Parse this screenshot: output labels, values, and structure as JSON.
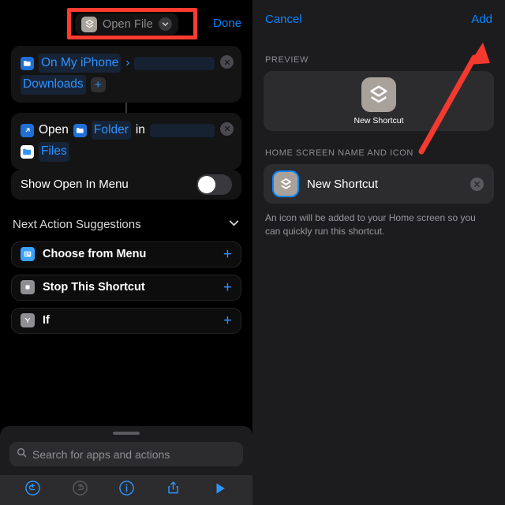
{
  "left": {
    "header": {
      "title_icon": "shortcut-layers-icon",
      "title": "Open File",
      "chevron_icon": "chevron-down-icon",
      "done_label": "Done"
    },
    "action_cards": [
      {
        "name": "file-picker-action",
        "icon": "folder-icon",
        "tokens": [
          "On My iPhone",
          "›",
          "Downloads"
        ],
        "add_label": "+",
        "remove_icon": "close-icon"
      },
      {
        "name": "open-folder-action",
        "icon": "open-app-icon",
        "word_open": "Open",
        "token_folder": "Folder",
        "word_in": "in",
        "token_files": "Files",
        "remove_icon": "close-icon"
      }
    ],
    "toggle": {
      "label": "Show Open In Menu",
      "state": "off"
    },
    "suggestions": {
      "title": "Next Action Suggestions",
      "collapse_icon": "chevron-down-icon",
      "items": [
        {
          "label": "Choose from Menu",
          "icon": "menu-icon",
          "icon_color": "#3aa3ff",
          "add": "+"
        },
        {
          "label": "Stop This Shortcut",
          "icon": "stop-square-icon",
          "icon_color": "#8e8e93",
          "add": "+"
        },
        {
          "label": "If",
          "icon": "branch-icon",
          "icon_color": "#8e8e93",
          "add": "+"
        }
      ]
    },
    "search": {
      "placeholder": "Search for apps and actions",
      "icon": "search-icon"
    },
    "toolbar": [
      {
        "name": "undo-button",
        "icon": "undo-icon",
        "enabled": true
      },
      {
        "name": "redo-button",
        "icon": "redo-icon",
        "enabled": false
      },
      {
        "name": "info-button",
        "icon": "info-icon",
        "enabled": true
      },
      {
        "name": "share-button",
        "icon": "share-icon",
        "enabled": true
      },
      {
        "name": "run-button",
        "icon": "play-icon",
        "enabled": true
      }
    ]
  },
  "right": {
    "cancel_label": "Cancel",
    "add_label": "Add",
    "preview_label": "PREVIEW",
    "preview": {
      "icon": "shortcut-layers-icon",
      "name": "New Shortcut"
    },
    "home_section_label": "HOME SCREEN NAME AND ICON",
    "name_field": {
      "icon": "shortcut-layers-icon",
      "value": "New Shortcut",
      "clear_icon": "close-icon"
    },
    "footnote": "An icon will be added to your Home screen so you can quickly run this shortcut."
  },
  "annotations": {
    "highlight_color": "#ff3b30",
    "rect_target": "Open File",
    "arrow_target": "Add"
  }
}
